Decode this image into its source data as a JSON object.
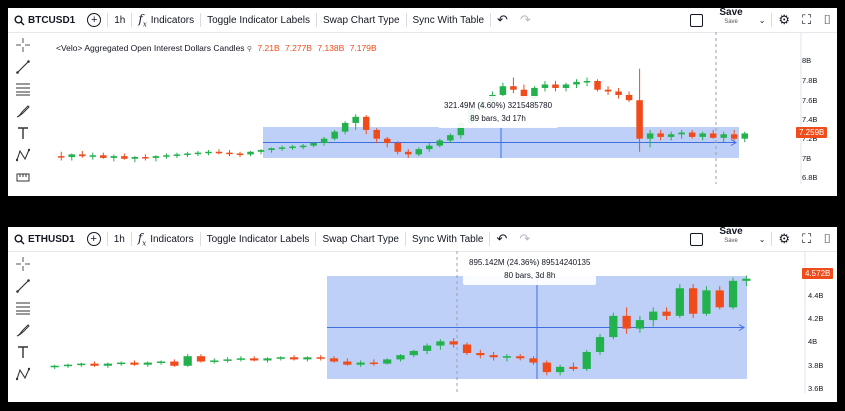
{
  "charts": [
    {
      "symbol": "BTCUSD1",
      "interval": "1h",
      "indicators_label": "Indicators",
      "toggle_label": "Toggle Indicator Labels",
      "swap_label": "Swap Chart Type",
      "sync_label": "Sync With Table",
      "save_label": "Save",
      "save_sublabel": "Save",
      "legend_title": "<Velo> Aggregated Open Interest Dollars Candles",
      "legend_values": [
        "7.21B",
        "7.277B",
        "7.138B",
        "7.179B"
      ],
      "tooltip_line1": "321.49M (4.60%) 3215485780",
      "tooltip_line2": "89 bars, 3d 17h",
      "price_ticks": [
        "8B",
        "7.8B",
        "7.6B",
        "7.4B",
        "7.2B",
        "7B",
        "6.8B"
      ],
      "current_price": "7.259B",
      "colors": {
        "up": "#22b14c",
        "down": "#f04b1a",
        "measure": "#a9c0f5",
        "measure_line": "#3d6fe0"
      }
    },
    {
      "symbol": "ETHUSD1",
      "interval": "1h",
      "indicators_label": "Indicators",
      "toggle_label": "Toggle Indicator Labels",
      "swap_label": "Swap Chart Type",
      "sync_label": "Sync With Table",
      "save_label": "Save",
      "save_sublabel": "Save",
      "tooltip_line1": "895.142M (24.36%) 89514240135",
      "tooltip_line2": "80 bars, 3d 8h",
      "price_ticks": [
        "4.4B",
        "4.2B",
        "4B",
        "3.8B",
        "3.6B"
      ],
      "current_price": "4.572B",
      "colors": {
        "up": "#22b14c",
        "down": "#f04b1a",
        "measure": "#a9c0f5",
        "measure_line": "#3d6fe0"
      }
    }
  ],
  "chart_data": [
    {
      "type": "candlestick",
      "title": "<Velo> Aggregated Open Interest Dollars Candles",
      "ylim": [
        6.75,
        8.1
      ],
      "ohlc": [
        [
          7.0,
          7.05,
          6.95,
          6.99
        ],
        [
          6.99,
          7.03,
          6.95,
          7.02
        ],
        [
          7.02,
          7.06,
          6.98,
          7.0
        ],
        [
          7.0,
          7.04,
          6.96,
          7.01
        ],
        [
          7.01,
          7.04,
          6.97,
          6.98
        ],
        [
          6.98,
          7.02,
          6.94,
          7.0
        ],
        [
          7.0,
          7.03,
          6.96,
          6.97
        ],
        [
          6.97,
          7.0,
          6.93,
          6.99
        ],
        [
          6.99,
          7.02,
          6.95,
          6.98
        ],
        [
          6.98,
          7.01,
          6.94,
          7.0
        ],
        [
          7.0,
          7.03,
          6.97,
          7.01
        ],
        [
          7.01,
          7.04,
          6.98,
          7.02
        ],
        [
          7.02,
          7.05,
          6.99,
          7.03
        ],
        [
          7.03,
          7.06,
          7.0,
          7.04
        ],
        [
          7.04,
          7.07,
          7.01,
          7.05
        ],
        [
          7.05,
          7.08,
          7.02,
          7.04
        ],
        [
          7.04,
          7.07,
          7.0,
          7.03
        ],
        [
          7.03,
          7.05,
          6.99,
          7.02
        ],
        [
          7.02,
          7.06,
          7.0,
          7.05
        ],
        [
          7.05,
          7.08,
          7.02,
          7.07
        ],
        [
          7.07,
          7.1,
          7.04,
          7.09
        ],
        [
          7.09,
          7.12,
          7.06,
          7.1
        ],
        [
          7.1,
          7.13,
          7.07,
          7.11
        ],
        [
          7.11,
          7.14,
          7.08,
          7.12
        ],
        [
          7.12,
          7.16,
          7.1,
          7.15
        ],
        [
          7.15,
          7.22,
          7.12,
          7.2
        ],
        [
          7.2,
          7.3,
          7.18,
          7.28
        ],
        [
          7.28,
          7.4,
          7.25,
          7.38
        ],
        [
          7.38,
          7.48,
          7.3,
          7.45
        ],
        [
          7.45,
          7.47,
          7.25,
          7.3
        ],
        [
          7.3,
          7.32,
          7.15,
          7.2
        ],
        [
          7.2,
          7.22,
          7.1,
          7.15
        ],
        [
          7.15,
          7.17,
          7.02,
          7.05
        ],
        [
          7.05,
          7.08,
          6.98,
          7.02
        ],
        [
          7.02,
          7.1,
          7.0,
          7.08
        ],
        [
          7.08,
          7.15,
          7.05,
          7.12
        ],
        [
          7.12,
          7.2,
          7.1,
          7.18
        ],
        [
          7.18,
          7.26,
          7.15,
          7.24
        ],
        [
          7.24,
          7.4,
          7.2,
          7.38
        ],
        [
          7.38,
          7.56,
          7.35,
          7.54
        ],
        [
          7.54,
          7.66,
          7.5,
          7.62
        ],
        [
          7.62,
          7.74,
          7.58,
          7.7
        ],
        [
          7.7,
          7.84,
          7.66,
          7.8
        ],
        [
          7.8,
          7.9,
          7.72,
          7.76
        ],
        [
          7.76,
          7.82,
          7.6,
          7.66
        ],
        [
          7.66,
          7.8,
          7.62,
          7.78
        ],
        [
          7.78,
          7.86,
          7.74,
          7.82
        ],
        [
          7.82,
          7.86,
          7.74,
          7.78
        ],
        [
          7.78,
          7.84,
          7.74,
          7.82
        ],
        [
          7.82,
          7.88,
          7.78,
          7.85
        ],
        [
          7.85,
          7.9,
          7.8,
          7.86
        ],
        [
          7.86,
          7.88,
          7.74,
          7.76
        ],
        [
          7.76,
          7.8,
          7.7,
          7.74
        ],
        [
          7.74,
          7.78,
          7.66,
          7.7
        ],
        [
          7.7,
          7.74,
          7.62,
          7.64
        ],
        [
          7.64,
          8.0,
          7.05,
          7.2
        ],
        [
          7.2,
          7.3,
          7.1,
          7.26
        ],
        [
          7.26,
          7.3,
          7.18,
          7.22
        ],
        [
          7.22,
          7.28,
          7.18,
          7.25
        ],
        [
          7.25,
          7.3,
          7.2,
          7.27
        ],
        [
          7.27,
          7.3,
          7.2,
          7.22
        ],
        [
          7.22,
          7.28,
          7.18,
          7.26
        ],
        [
          7.26,
          7.3,
          7.2,
          7.21
        ],
        [
          7.21,
          7.28,
          7.16,
          7.25
        ],
        [
          7.25,
          7.3,
          7.18,
          7.2
        ],
        [
          7.2,
          7.28,
          7.16,
          7.26
        ]
      ]
    },
    {
      "type": "candlestick",
      "ylim": [
        3.55,
        4.68
      ],
      "ohlc": [
        [
          3.74,
          3.76,
          3.72,
          3.75
        ],
        [
          3.75,
          3.77,
          3.73,
          3.76
        ],
        [
          3.76,
          3.78,
          3.74,
          3.77
        ],
        [
          3.77,
          3.79,
          3.74,
          3.75
        ],
        [
          3.75,
          3.78,
          3.73,
          3.77
        ],
        [
          3.77,
          3.79,
          3.75,
          3.78
        ],
        [
          3.78,
          3.8,
          3.75,
          3.76
        ],
        [
          3.76,
          3.79,
          3.74,
          3.78
        ],
        [
          3.78,
          3.8,
          3.76,
          3.79
        ],
        [
          3.79,
          3.81,
          3.74,
          3.75
        ],
        [
          3.75,
          3.86,
          3.74,
          3.84
        ],
        [
          3.84,
          3.86,
          3.78,
          3.79
        ],
        [
          3.79,
          3.82,
          3.77,
          3.8
        ],
        [
          3.8,
          3.83,
          3.78,
          3.81
        ],
        [
          3.81,
          3.84,
          3.79,
          3.82
        ],
        [
          3.82,
          3.84,
          3.79,
          3.8
        ],
        [
          3.8,
          3.83,
          3.78,
          3.82
        ],
        [
          3.82,
          3.84,
          3.8,
          3.83
        ],
        [
          3.83,
          3.85,
          3.8,
          3.81
        ],
        [
          3.81,
          3.84,
          3.79,
          3.83
        ],
        [
          3.83,
          3.85,
          3.8,
          3.82
        ],
        [
          3.82,
          3.84,
          3.78,
          3.79
        ],
        [
          3.79,
          3.82,
          3.75,
          3.76
        ],
        [
          3.76,
          3.8,
          3.74,
          3.78
        ],
        [
          3.78,
          3.81,
          3.75,
          3.77
        ],
        [
          3.77,
          3.82,
          3.76,
          3.81
        ],
        [
          3.81,
          3.86,
          3.79,
          3.85
        ],
        [
          3.85,
          3.9,
          3.83,
          3.89
        ],
        [
          3.89,
          3.96,
          3.86,
          3.94
        ],
        [
          3.94,
          4.0,
          3.9,
          3.98
        ],
        [
          3.98,
          4.01,
          3.92,
          3.95
        ],
        [
          3.95,
          3.97,
          3.85,
          3.87
        ],
        [
          3.87,
          3.9,
          3.82,
          3.85
        ],
        [
          3.85,
          3.88,
          3.8,
          3.83
        ],
        [
          3.83,
          3.86,
          3.79,
          3.84
        ],
        [
          3.84,
          3.86,
          3.8,
          3.82
        ],
        [
          3.82,
          3.84,
          3.76,
          3.78
        ],
        [
          3.78,
          3.8,
          3.66,
          3.69
        ],
        [
          3.69,
          3.76,
          3.66,
          3.74
        ],
        [
          3.74,
          3.78,
          3.7,
          3.72
        ],
        [
          3.72,
          3.9,
          3.7,
          3.88
        ],
        [
          3.88,
          4.05,
          3.85,
          4.02
        ],
        [
          4.02,
          4.25,
          4.0,
          4.22
        ],
        [
          4.22,
          4.3,
          4.05,
          4.1
        ],
        [
          4.1,
          4.22,
          4.06,
          4.18
        ],
        [
          4.18,
          4.3,
          4.12,
          4.26
        ],
        [
          4.26,
          4.3,
          4.18,
          4.22
        ],
        [
          4.22,
          4.52,
          4.2,
          4.48
        ],
        [
          4.48,
          4.52,
          4.2,
          4.24
        ],
        [
          4.24,
          4.5,
          4.22,
          4.46
        ],
        [
          4.46,
          4.5,
          4.28,
          4.3
        ],
        [
          4.3,
          4.58,
          4.28,
          4.55
        ],
        [
          4.55,
          4.6,
          4.5,
          4.57
        ]
      ]
    }
  ]
}
